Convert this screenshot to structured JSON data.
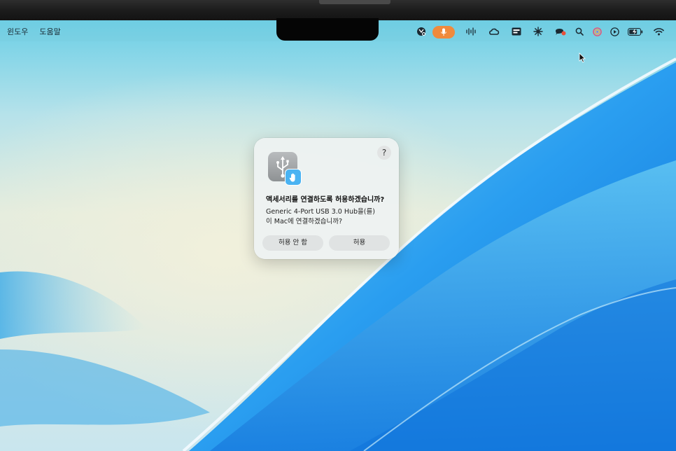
{
  "menubar": {
    "menu_items": [
      "윈도우",
      "도움말"
    ],
    "status_icons": [
      "scrollbar-app-icon",
      "microphone-icon",
      "audio-waveform-icon",
      "creative-cloud-icon",
      "display-app-icon",
      "sparkle-icon",
      "chat-icon",
      "search-icon",
      "color-wheel-icon",
      "play-icon",
      "battery-icon",
      "wifi-icon"
    ]
  },
  "dialog": {
    "help_label": "?",
    "title": "액세서리를 연결하도록 허용하겠습니까?",
    "body_line1": "Generic 4-Port USB 3.0 Hub을(를)",
    "body_line2": "이 Mac에 연결하겠습니까?",
    "deny_label": "허용 안 함",
    "allow_label": "허용",
    "icon": "usb-accessory-icon",
    "badge_icon": "hand-icon"
  },
  "colors": {
    "mic_indicator": "#f08a3c",
    "badge": "#4ab3f2",
    "wallpaper_blue": "#1a8be6"
  }
}
